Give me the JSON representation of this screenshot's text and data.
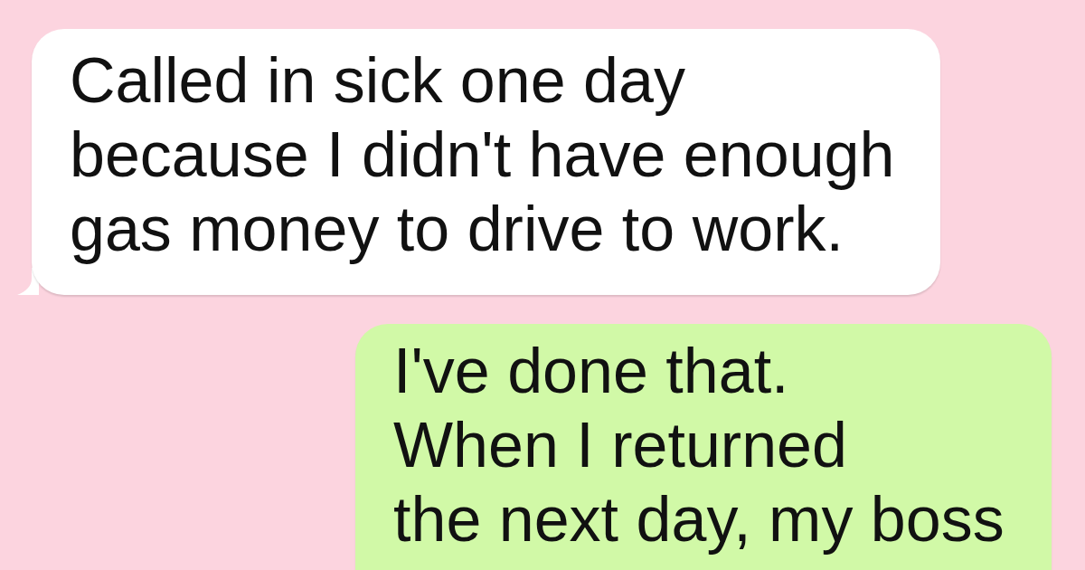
{
  "messages": [
    {
      "kind": "received",
      "text": "Called in sick one day\nbecause I didn't have enough\ngas money to drive to work."
    },
    {
      "kind": "sent",
      "text": "I've done that.\nWhen I returned\nthe next day, my boss"
    }
  ]
}
